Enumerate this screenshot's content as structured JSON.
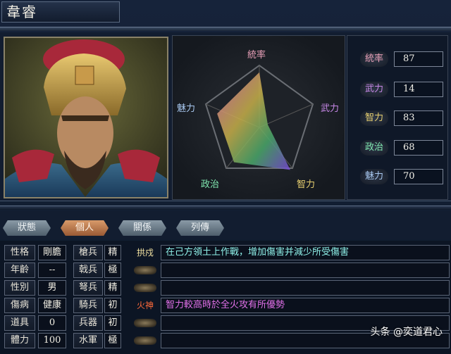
{
  "general": {
    "name": "韋睿"
  },
  "radar": {
    "labels": {
      "leadership": "統率",
      "strength": "武力",
      "intelligence": "智力",
      "politics": "政治",
      "charm": "魅力"
    }
  },
  "stats": [
    {
      "label": "統率",
      "value": "87",
      "color": "#e8a0b8"
    },
    {
      "label": "武力",
      "value": "14",
      "color": "#c888e8"
    },
    {
      "label": "智力",
      "value": "83",
      "color": "#e8d070"
    },
    {
      "label": "政治",
      "value": "68",
      "color": "#80e8b0"
    },
    {
      "label": "魅力",
      "value": "70",
      "color": "#a8c8f0"
    }
  ],
  "tabs": [
    "狀態",
    "個人",
    "關係",
    "列傳"
  ],
  "active_tab": "個人",
  "personal": {
    "rows": [
      {
        "label": "性格",
        "value": "剛膽",
        "unit": "槍兵",
        "grade": "精"
      },
      {
        "label": "年齡",
        "value": "--",
        "unit": "戟兵",
        "grade": "極"
      },
      {
        "label": "性別",
        "value": "男",
        "unit": "弩兵",
        "grade": "精"
      },
      {
        "label": "傷病",
        "value": "健康",
        "unit": "騎兵",
        "grade": "初"
      },
      {
        "label": "道具",
        "value": "0",
        "unit": "兵器",
        "grade": "初"
      },
      {
        "label": "體力",
        "value": "100",
        "unit": "水軍",
        "grade": "極"
      }
    ]
  },
  "skills": [
    {
      "name": "拱戍",
      "desc": "在己方領土上作戰，增加傷害并減少所受傷害",
      "name_color": "#f0e0a0",
      "desc_color": "#8ff0e8"
    },
    {
      "name": "",
      "desc": ""
    },
    {
      "name": "",
      "desc": ""
    },
    {
      "name": "火神",
      "desc": "智力較高時於全火攻有所優勢",
      "name_color": "#ff6a3a",
      "desc_color": "#e070e8"
    },
    {
      "name": "",
      "desc": ""
    },
    {
      "name": "",
      "desc": ""
    }
  ],
  "watermark": "头条 @奕道君心"
}
